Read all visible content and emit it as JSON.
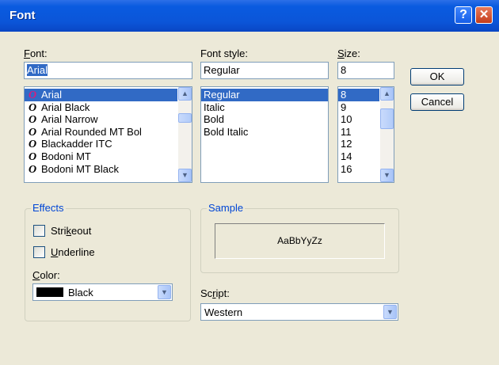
{
  "window": {
    "title": "Font"
  },
  "labels": {
    "font": "Font:",
    "font_style": "Font style:",
    "size": "Size:",
    "color": "Color:",
    "script": "Script:"
  },
  "font": {
    "value": "Arial",
    "items": [
      "Arial",
      "Arial Black",
      "Arial Narrow",
      "Arial Rounded MT Bol",
      "Blackadder ITC",
      "Bodoni MT",
      "Bodoni MT Black"
    ]
  },
  "font_style": {
    "value": "Regular",
    "items": [
      "Regular",
      "Italic",
      "Bold",
      "Bold Italic"
    ]
  },
  "size": {
    "value": "8",
    "items": [
      "8",
      "9",
      "10",
      "11",
      "12",
      "14",
      "16"
    ]
  },
  "buttons": {
    "ok": "OK",
    "cancel": "Cancel"
  },
  "effects": {
    "title": "Effects",
    "strikeout": "Strikeout",
    "underline": "Underline",
    "color_value": "Black"
  },
  "sample": {
    "title": "Sample",
    "text": "AaBbYyZz"
  },
  "script_value": "Western",
  "icons": {
    "font_item": "opentype-font-icon",
    "scroll_up": "scroll-up-arrow",
    "scroll_down": "scroll-down-arrow",
    "dropdown": "chevron-down-icon"
  },
  "colors": {
    "selection": "#316ac5",
    "group_label": "#0046d5",
    "titlebar": "#0a5be0"
  }
}
